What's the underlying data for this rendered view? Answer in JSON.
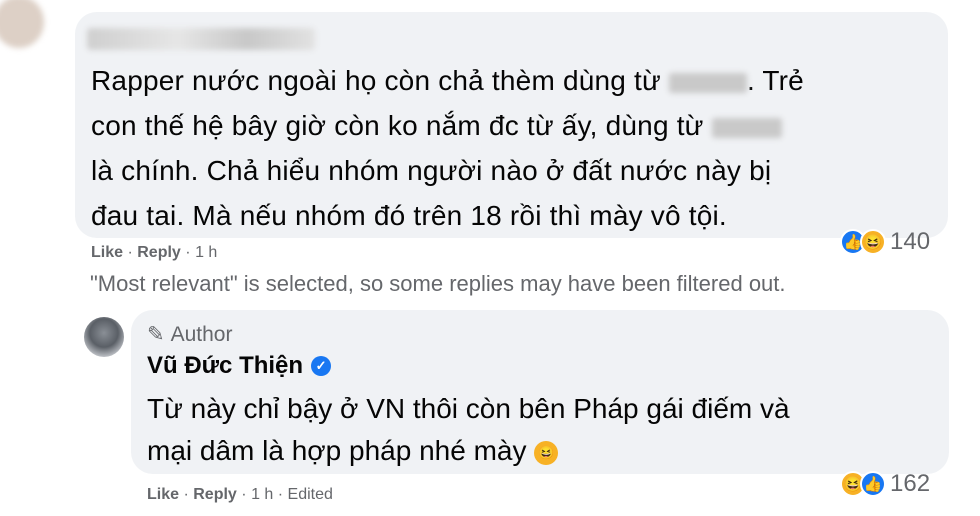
{
  "comment1": {
    "lines": [
      [
        "Rapper nước ngoài họ còn chả thèm dùng từ ",
        ". Trẻ"
      ],
      [
        "con thế hệ bây giờ còn ko nắm đc từ ấy, dùng từ ",
        ""
      ],
      [
        "là chính. Chả hiểu nhóm người nào ở đất nước này bị",
        ""
      ],
      [
        "đau tai. Mà nếu nhóm đó trên 18 rồi thì mày vô tội.",
        ""
      ]
    ],
    "actions": {
      "like": "Like",
      "reply": "Reply",
      "sep": "·",
      "time": "1 h"
    },
    "reaction_count": "140",
    "reaction_icons": [
      "like-icon",
      "haha-icon"
    ]
  },
  "filter_note": "\"Most relevant\" is selected, so some replies may have been filtered out.",
  "reply": {
    "author_label": "Author",
    "name": "Vũ Đức Thiện",
    "text_line1": "Từ này chỉ bậy ở VN thôi còn bên Pháp gái điếm và",
    "text_line2": "mại dâm là hợp pháp nhé mày",
    "actions": {
      "like": "Like",
      "reply": "Reply",
      "sep": "·",
      "time": "1 h",
      "edited": "Edited"
    },
    "reaction_count": "162",
    "reaction_icons": [
      "haha-icon",
      "like-icon"
    ]
  },
  "colors": {
    "bubble": "#f0f2f5",
    "meta": "#65676b",
    "accent": "#1877f2"
  }
}
